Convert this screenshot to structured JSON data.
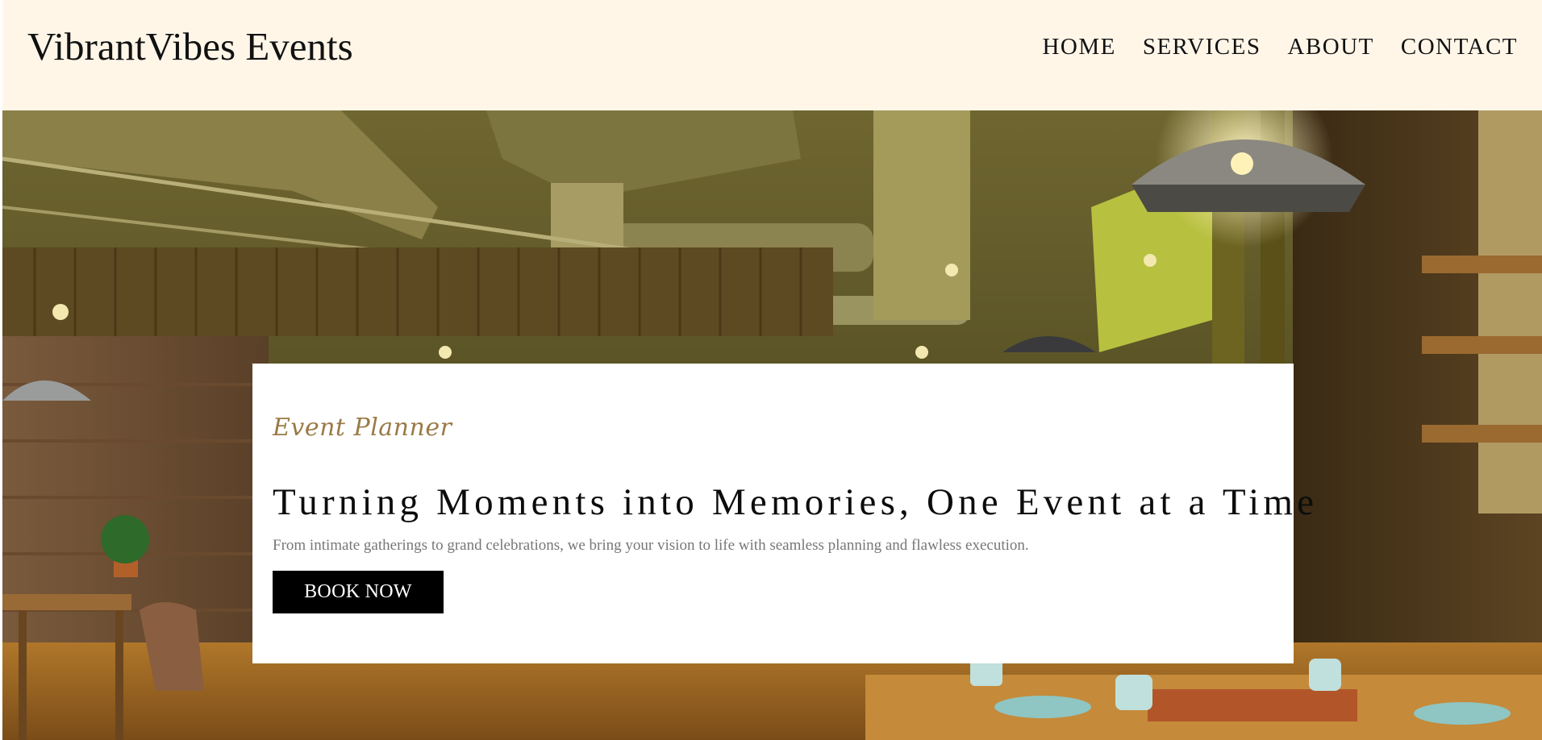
{
  "header": {
    "brand": "VibrantVibes Events",
    "nav": [
      {
        "label": "HOME"
      },
      {
        "label": "SERVICES"
      },
      {
        "label": "ABOUT"
      },
      {
        "label": "CONTACT"
      }
    ]
  },
  "hero": {
    "image_alt": "Restaurant interior with wooden tables, pendant lamps and exposed ceiling ducts",
    "eyebrow": "Event Planner",
    "headline": "Turning Moments into Memories, One Event at a Time",
    "subtext": "From intimate gatherings to grand celebrations, we bring your vision to life with seamless planning and flawless execution.",
    "cta_label": "BOOK NOW"
  },
  "colors": {
    "header_bg": "#fff6e8",
    "eyebrow": "#9a7a46",
    "cta_bg": "#000000",
    "cta_text": "#ffffff"
  }
}
